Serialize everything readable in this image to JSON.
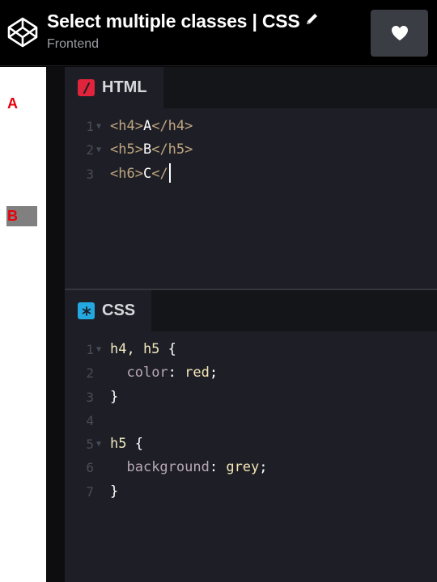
{
  "header": {
    "title": "Select multiple classes | CSS",
    "subtitle": "Frontend"
  },
  "preview": {
    "h4_text": "A",
    "h5_text": "B",
    "text_color": "#e8000a",
    "h5_background": "#808080"
  },
  "html_editor": {
    "tab_label": "HTML",
    "tab_icon_color": "#e0243c",
    "lines": [
      {
        "num": "1",
        "open_tag": "<h4>",
        "text": "A",
        "close_tag": "</h4>"
      },
      {
        "num": "2",
        "open_tag": "<h5>",
        "text": "B",
        "close_tag": "</h5>"
      },
      {
        "num": "3",
        "open_tag": "<h6>",
        "text": "C",
        "close_tag": "</"
      }
    ]
  },
  "css_editor": {
    "tab_label": "CSS",
    "tab_icon_color": "#23a8e0",
    "lines": [
      {
        "num": "1",
        "selector": "h4, h5",
        "brace": " {"
      },
      {
        "num": "2",
        "property": "color",
        "colon": ": ",
        "value": "red",
        "semi": ";"
      },
      {
        "num": "3",
        "brace": "}"
      },
      {
        "num": "4"
      },
      {
        "num": "5",
        "selector": "h5",
        "brace": " {"
      },
      {
        "num": "6",
        "property": "background",
        "colon": ": ",
        "value": "grey",
        "semi": ";"
      },
      {
        "num": "7",
        "brace": "}"
      }
    ]
  },
  "icons": {
    "logo": "codepen-logo-icon",
    "edit": "pencil-icon",
    "like": "heart-icon",
    "fold": "fold-arrow-icon"
  }
}
